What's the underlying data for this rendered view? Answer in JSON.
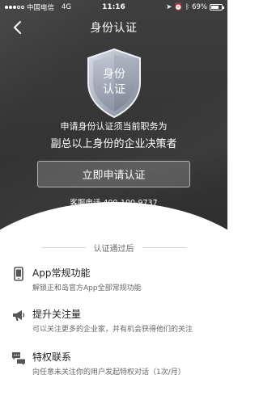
{
  "status_bar": {
    "carrier": "中国电信",
    "network": "4G",
    "time": "11:16",
    "battery": "69%"
  },
  "nav": {
    "title": "身份认证"
  },
  "shield": {
    "line1": "身份",
    "line2": "认证"
  },
  "hero": {
    "line1": "申请身份认证须当前职务为",
    "line2": "副总以上身份的企业决策者",
    "cta_label": "立即申请认证",
    "phone": "客服电话 400-100-9737"
  },
  "benefits": {
    "title": "认证通过后",
    "items": [
      {
        "icon": "phone-icon",
        "title": "App常规功能",
        "desc": "解锁正和岛官方App全部常规功能"
      },
      {
        "icon": "megaphone-icon",
        "title": "提升关注量",
        "desc": "可以关注更多的企业家，并有机会获得他们的关注"
      },
      {
        "icon": "chat-bubbles-icon",
        "title": "特权联系",
        "desc": "向任意未关注你的用户发起特权对话（1次/月）"
      }
    ]
  },
  "colors": {
    "hero_bg": "#353535",
    "text_dark": "#222222",
    "text_muted": "#666666"
  }
}
